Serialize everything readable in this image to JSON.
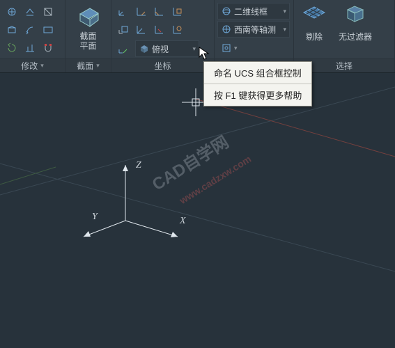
{
  "panels": {
    "modify": {
      "title": "修改",
      "dd": "▾"
    },
    "section": {
      "title": "截面",
      "dd": "▾",
      "btn_l1": "截面",
      "btn_l2": "平面"
    },
    "coord": {
      "title": "坐标",
      "combo_label": "俯视",
      "combo_dd": "▾"
    },
    "select": {
      "title": "选择",
      "erase": "剔除",
      "nofilter": "无过滤器"
    }
  },
  "view_combos": {
    "visual": "二维线框",
    "viewdir": "西南等轴测"
  },
  "tooltip": {
    "title": "命名 UCS 组合框控制",
    "help": "按 F1 键获得更多帮助"
  },
  "axes": {
    "x": "X",
    "y": "Y",
    "z": "Z"
  },
  "watermark": {
    "text": "CAD自学网",
    "url": "www.cadzxw.com"
  }
}
